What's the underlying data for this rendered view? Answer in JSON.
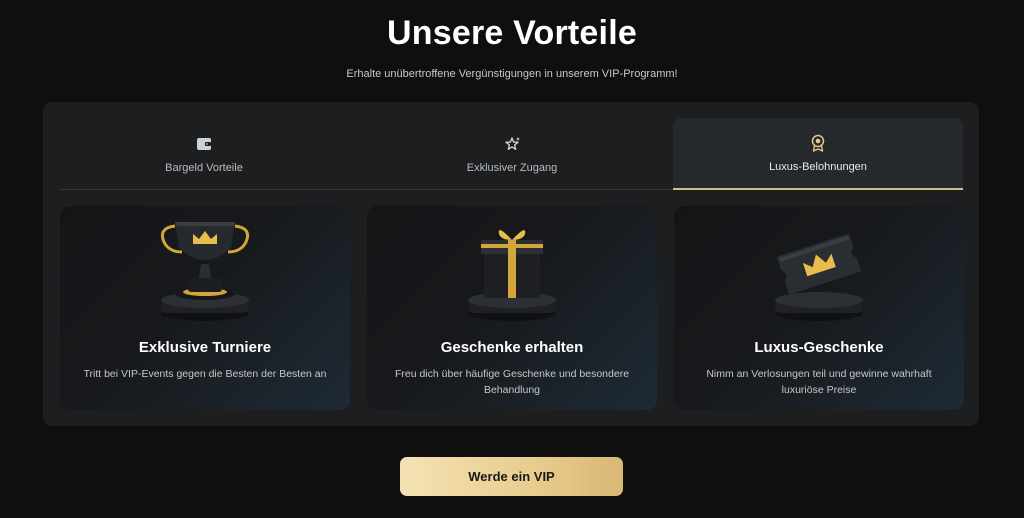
{
  "header": {
    "title": "Unsere Vorteile",
    "subtitle": "Erhalte unübertroffene Vergünstigungen in unserem VIP-Programm!"
  },
  "tabs": [
    {
      "label": "Bargeld Vorteile",
      "icon": "wallet-icon",
      "active": false
    },
    {
      "label": "Exklusiver Zugang",
      "icon": "stars-icon",
      "active": false
    },
    {
      "label": "Luxus-Belohnungen",
      "icon": "award-icon",
      "active": true
    }
  ],
  "cards": [
    {
      "title": "Exklusive Turniere",
      "text": "Tritt bei VIP-Events gegen die Besten der Besten an",
      "icon": "trophy-icon"
    },
    {
      "title": "Geschenke erhalten",
      "text": "Freu dich über häufige Geschenke und besondere Behandlung",
      "icon": "gift-icon"
    },
    {
      "title": "Luxus-Geschenke",
      "text": "Nimm an Verlosungen teil und gewinne wahrhaft luxuriöse Preise",
      "icon": "ticket-icon"
    }
  ],
  "cta": {
    "label": "Werde ein VIP"
  },
  "colors": {
    "accent_gold": "#d9bd80",
    "background": "#0f0f10",
    "panel": "#1c1e20"
  }
}
